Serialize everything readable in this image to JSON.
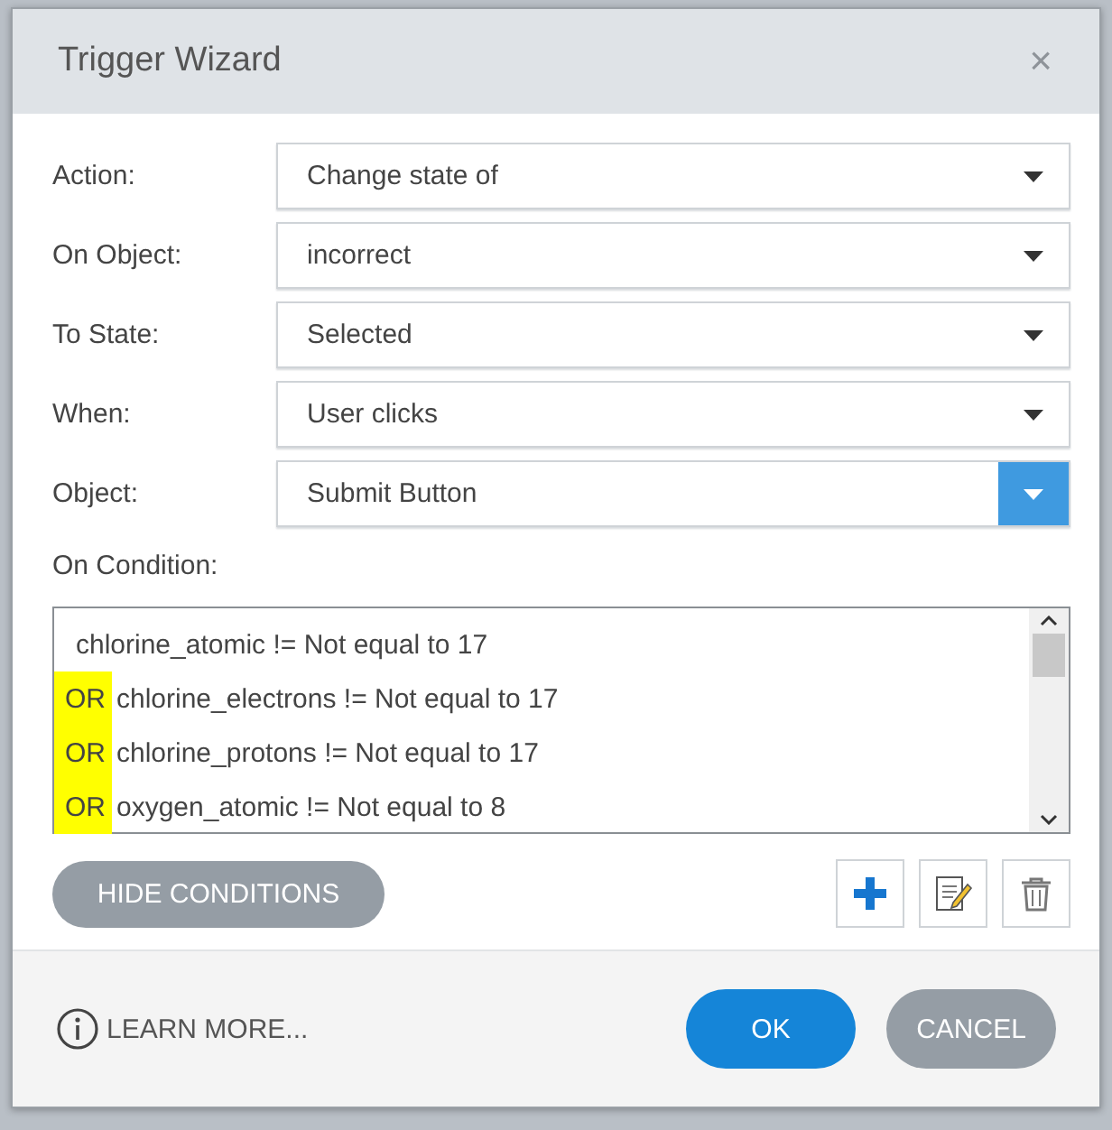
{
  "window": {
    "title": "Trigger Wizard",
    "close": "×"
  },
  "fields": [
    {
      "label": "Action:",
      "value": "Change state of",
      "active": false
    },
    {
      "label": "On Object:",
      "value": "incorrect",
      "active": false
    },
    {
      "label": "To State:",
      "value": "Selected",
      "active": false
    },
    {
      "label": "When:",
      "value": "User clicks",
      "active": false
    },
    {
      "label": "Object:",
      "value": "Submit Button",
      "active": true
    }
  ],
  "conditions_label": "On Condition:",
  "conditions": [
    {
      "text": "chlorine_atomic != Not equal to 17"
    },
    {
      "operator": "OR",
      "text": "chlorine_electrons != Not equal to 17",
      "highlighted": true
    },
    {
      "operator": "OR",
      "text": "chlorine_protons != Not equal to 17",
      "highlighted": true
    },
    {
      "operator": "OR",
      "text": "oxygen_atomic != Not equal to 8",
      "highlighted": true
    }
  ],
  "hide_conditions": "HIDE CONDITIONS",
  "learn_more": "LEARN MORE...",
  "buttons": [
    {
      "label": "OK",
      "kind": "primary"
    },
    {
      "label": "CANCEL",
      "kind": "secondary"
    }
  ]
}
